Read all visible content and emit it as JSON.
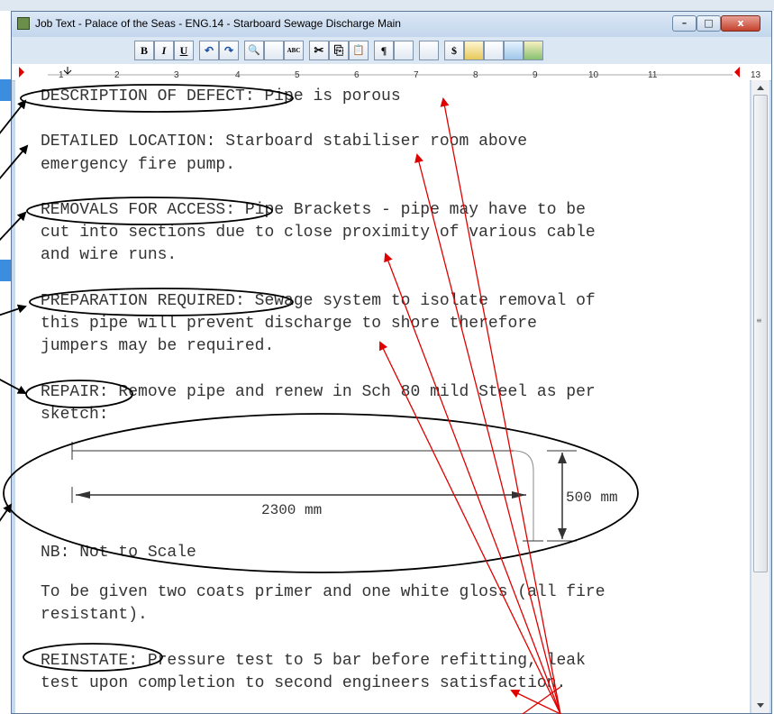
{
  "window": {
    "title": "Job Text - Palace of the Seas - ENG.14 - Starboard Sewage Discharge Main",
    "minimize": "–",
    "maximize": "□",
    "close": "x"
  },
  "toolbar": {
    "bold": "B",
    "italic": "I",
    "underline": "U",
    "undo": "↶",
    "redo": "↷",
    "find": "🔍",
    "spell": "ABC",
    "cut": "✂",
    "copy": "⎘",
    "paste": "📋",
    "paragraph": "¶",
    "dollar": "$"
  },
  "ruler": {
    "numbers": [
      "1",
      "2",
      "3",
      "4",
      "5",
      "6",
      "7",
      "8",
      "9",
      "10",
      "11",
      "13"
    ]
  },
  "document": {
    "line1": "DESCRIPTION OF DEFECT: Pipe is porous",
    "line2a": "DETAILED LOCATION: Starboard stabiliser room above",
    "line2b": "emergency fire pump.",
    "line3a": "REMOVALS FOR ACCESS: Pipe Brackets - pipe may have to be",
    "line3b": "cut into sections due to close proximity of various cable",
    "line3c": "and wire runs.",
    "line4a": "PREPARATION REQUIRED: Sewage system to isolate removal of",
    "line4b": "this pipe will prevent discharge to shore therefore",
    "line4c": "jumpers may be required.",
    "line5a": "REPAIR: Remove pipe and renew in Sch 80 mild Steel as per",
    "line5b": "sketch:",
    "dim_length": "2300 mm",
    "dim_height": "500 mm",
    "note": "NB: Not to Scale",
    "line6a": "To be given two coats primer and one white gloss (all fire",
    "line6b": "resistant).",
    "line7a": "REINSTATE: Pressure test to 5 bar before refitting, leak",
    "line7b": "test upon completion to second engineers satisfaction."
  }
}
